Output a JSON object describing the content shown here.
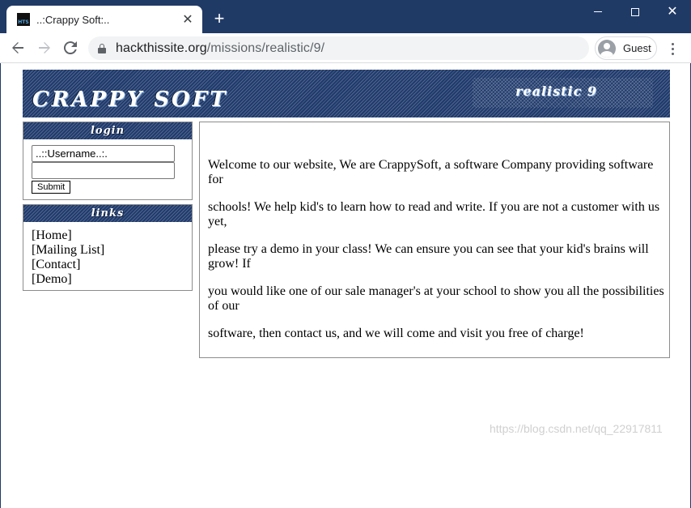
{
  "browser": {
    "tab_title": "..:Crappy Soft:..",
    "favicon_text": "HTS",
    "url_domain": "hackthissite.org",
    "url_path": "/missions/realistic/9/",
    "profile_label": "Guest"
  },
  "banner": {
    "title": "CRAPPY SOFT",
    "subtitle": "realistic 9"
  },
  "login": {
    "heading": "login",
    "username_value": "..::Username..:.",
    "password_value": "",
    "submit_label": "Submit"
  },
  "links": {
    "heading": "links",
    "items": [
      {
        "label": "[Home]"
      },
      {
        "label": "[Mailing List]"
      },
      {
        "label": "[Contact]"
      },
      {
        "label": "[Demo]"
      }
    ]
  },
  "content": {
    "paragraphs": [
      "Welcome to our website, We are CrappySoft, a software Company providing software for",
      "schools! We help kid's to learn how to read and write. If you are not a customer with us yet,",
      "please try a demo in your class! We can ensure you can see that your kid's brains will grow! If",
      "you would like one of our sale manager's at your school to show you all the possibilities of our",
      "software, then contact us, and we will come and visit you free of charge!"
    ]
  },
  "watermark": "https://blog.csdn.net/qq_22917811"
}
